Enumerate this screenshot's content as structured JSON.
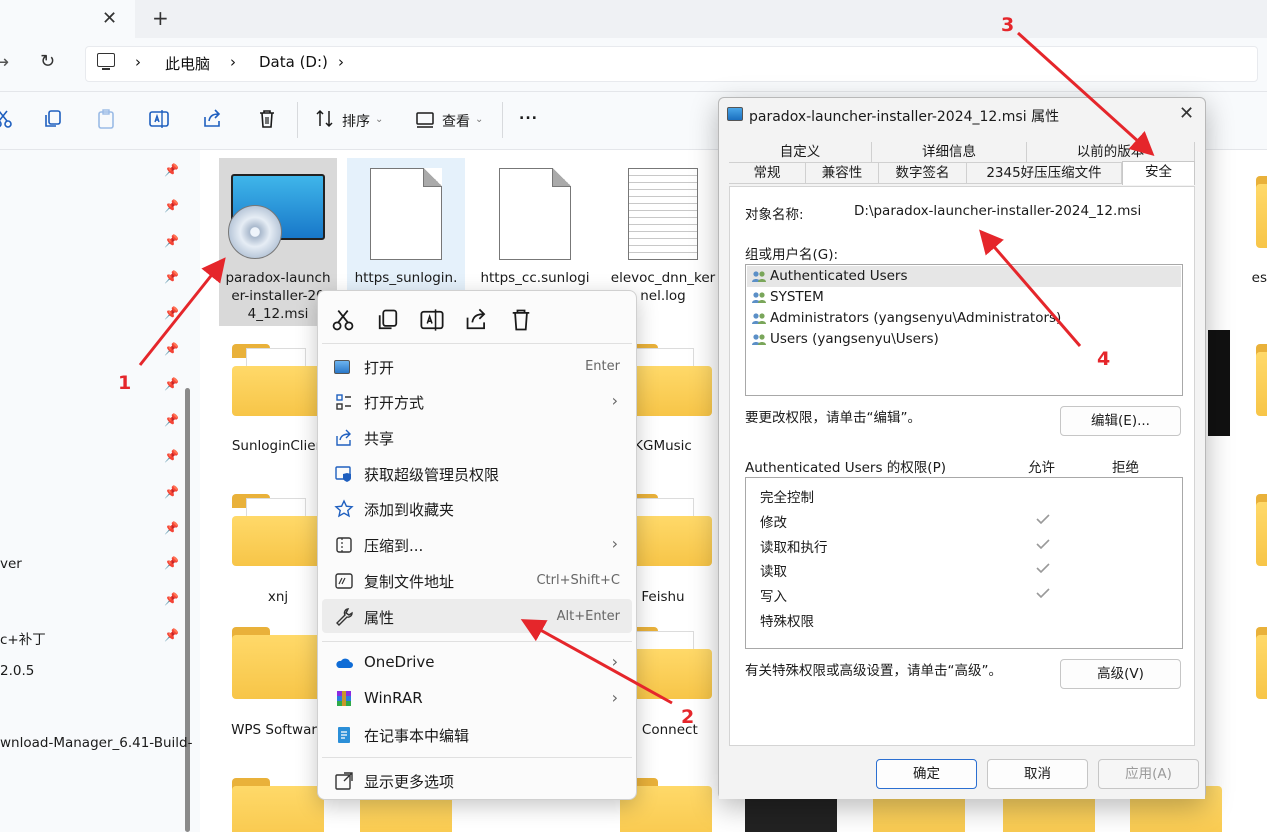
{
  "explorer": {
    "breadcrumb": [
      "此电脑",
      "Data (D:)"
    ],
    "toolbar": {
      "sort_label": "排序",
      "view_label": "查看",
      "more_label": "..."
    },
    "sidebar_items": [
      "ver",
      "c+补丁",
      "2.0.5",
      "wnload-Manager_6.41-Build-"
    ],
    "files": [
      {
        "name_lines": [
          "paradox-launch",
          "er-installer-20",
          "4_12.msi"
        ],
        "kind": "msi",
        "selected": true
      },
      {
        "name_lines": [
          "https_sunlogin."
        ],
        "kind": "doc",
        "selected": true
      },
      {
        "name_lines": [
          "https_cc.sunlogi"
        ],
        "kind": "doc"
      },
      {
        "name_lines": [
          "elevoc_dnn_ker",
          "nel.log"
        ],
        "kind": "log"
      },
      {
        "name_lines": [
          "SunloginClien"
        ],
        "kind": "folder"
      },
      {
        "name_lines": [
          "KGMusic"
        ],
        "kind": "folder"
      },
      {
        "name_lines": [
          "xnj"
        ],
        "kind": "folder"
      },
      {
        "name_lines": [
          "Feishu"
        ],
        "kind": "folder"
      },
      {
        "name_lines": [
          "WPS Software"
        ],
        "kind": "folder"
      },
      {
        "name_lines": [
          "C Connect"
        ],
        "kind": "folder"
      },
      {
        "name_lines": [
          "es"
        ],
        "kind": "folder"
      }
    ]
  },
  "context_menu": {
    "items": [
      {
        "label": "打开",
        "shortcut": "Enter",
        "icon": "open-window-icon"
      },
      {
        "label": "打开方式",
        "submenu": true,
        "icon": "open-with-icon"
      },
      {
        "label": "共享",
        "icon": "share-icon"
      },
      {
        "label": "获取超级管理员权限",
        "icon": "admin-shield-icon"
      },
      {
        "label": "添加到收藏夹",
        "icon": "star-icon"
      },
      {
        "label": "压缩到...",
        "submenu": true,
        "icon": "compress-icon"
      },
      {
        "label": "复制文件地址",
        "shortcut": "Ctrl+Shift+C",
        "icon": "copy-path-icon"
      },
      {
        "label": "属性",
        "shortcut": "Alt+Enter",
        "icon": "wrench-icon",
        "hover": true
      },
      {
        "label": "OneDrive",
        "submenu": true,
        "icon": "onedrive-cloud-icon"
      },
      {
        "label": "WinRAR",
        "submenu": true,
        "icon": "winrar-icon"
      },
      {
        "label": "在记事本中编辑",
        "icon": "notepad-icon"
      },
      {
        "label": "显示更多选项",
        "icon": "more-options-icon"
      }
    ]
  },
  "properties_dialog": {
    "title": "paradox-launcher-installer-2024_12.msi 属性",
    "tabs_row1": [
      "自定义",
      "详细信息",
      "以前的版本"
    ],
    "tabs_row2": [
      "常规",
      "兼容性",
      "数字签名",
      "2345好压压缩文件",
      "安全"
    ],
    "active_tab": "安全",
    "object_name_label": "对象名称:",
    "object_name_value": "D:\\paradox-launcher-installer-2024_12.msi",
    "groups_label": "组或用户名(G):",
    "groups": [
      "Authenticated Users",
      "SYSTEM",
      "Administrators (yangsenyu\\Administrators)",
      "Users (yangsenyu\\Users)"
    ],
    "change_perm_text": "要更改权限，请单击“编辑”。",
    "edit_button": "编辑(E)...",
    "perm_header": "Authenticated Users 的权限(P)",
    "allow_label": "允许",
    "deny_label": "拒绝",
    "permissions": [
      {
        "name": "完全控制",
        "allow": false
      },
      {
        "name": "修改",
        "allow": true
      },
      {
        "name": "读取和执行",
        "allow": true
      },
      {
        "name": "读取",
        "allow": true
      },
      {
        "name": "写入",
        "allow": true
      },
      {
        "name": "特殊权限",
        "allow": false
      }
    ],
    "advanced_text": "有关特殊权限或高级设置，请单击“高级”。",
    "advanced_button": "高级(V)",
    "ok_button": "确定",
    "cancel_button": "取消",
    "apply_button": "应用(A)"
  },
  "annotations": [
    "1",
    "2",
    "3",
    "4"
  ],
  "colors": {
    "accent": "#1f5fbf",
    "annotation": "#e5262b",
    "folder": "#f7c548"
  }
}
